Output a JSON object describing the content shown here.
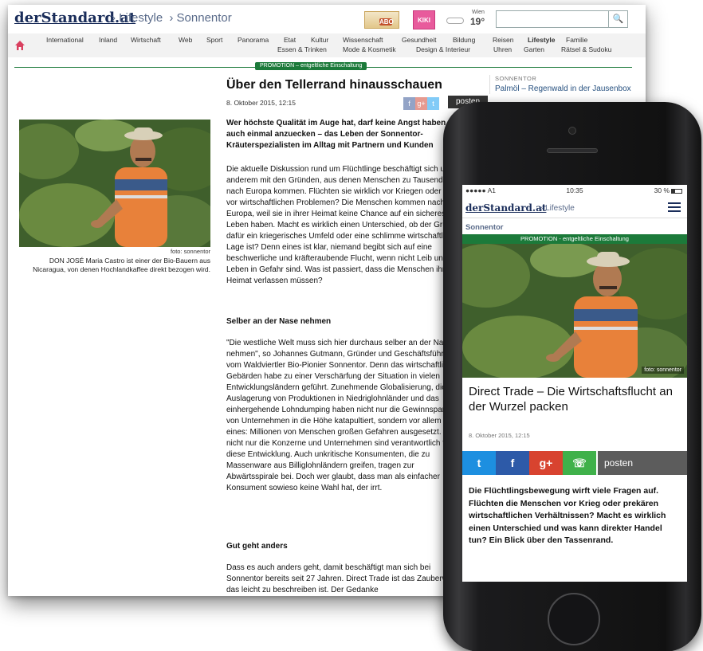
{
  "desktop": {
    "logo": "derStandard.at",
    "crumbs": [
      "› Lifestyle",
      "› Sonnentor"
    ],
    "badges": {
      "abo": "ABO",
      "kiki": "KIKI"
    },
    "weather": {
      "city": "Wien",
      "temp": "19°"
    },
    "search": {
      "placeholder": "",
      "button": "🔍"
    },
    "nav_top": [
      "International",
      "Inland",
      "Wirtschaft",
      "Web",
      "Sport",
      "Panorama",
      "Etat",
      "Kultur",
      "Wissenschaft",
      "Gesundheit",
      "Bildung",
      "Reisen",
      "Lifestyle",
      "Familie"
    ],
    "nav_sub": [
      "Essen & Trinken",
      "Mode & Kosmetik",
      "Design & Interieur",
      "Uhren",
      "Garten",
      "Rätsel & Sudoku"
    ],
    "promo": "PROMOTION – entgeltliche Einschaltung",
    "title": "Über den Tellerrand hinausschauen",
    "date": "8. Oktober 2015, 12:15",
    "share": [
      "f",
      "g+",
      "t"
    ],
    "posten": "posten",
    "lead": "Wer höchste Qualität im Auge hat, darf keine Angst haben, auch einmal anzuecken – das Leben der Sonnentor-Kräuterspezialisten im Alltag mit Partnern und Kunden",
    "para1": "Die aktuelle Diskussion rund um Flüchtlinge beschäftigt sich unter anderem mit den Gründen, aus denen Menschen zu Tausenden nach Europa kommen. Flüchten sie wirklich vor Kriegen oder gar vor wirtschaftlichen Problemen? Die Menschen kommen nach Europa, weil sie in ihrer Heimat keine Chance auf ein sicheres Leben haben. Macht es wirklich einen Unterschied, ob der Grund dafür ein kriegerisches Umfeld oder eine schlimme wirtschaftliche Lage ist? Denn eines ist klar, niemand begibt sich auf eine beschwerliche und kräfteraubende Flucht, wenn nicht Leib und Leben in Gefahr sind. Was ist passiert, dass die Menschen ihre Heimat verlassen müssen?",
    "sub1": "Selber an der Nase nehmen",
    "para2": "\"Die westliche Welt muss sich hier durchaus selber an der Nase nehmen\", so Johannes Gutmann, Gründer und Geschäftsführer vom Waldviertler Bio-Pionier Sonnentor. Denn das wirtschaftliche Gebärden habe zu einer Verschärfung der Situation in vielen Entwicklungsländern geführt. Zunehmende Globalisierung, die Auslagerung von Produktionen in Niedriglohnländer und das einhergehende Lohndumping haben nicht nur die Gewinnspanne von Unternehmen in die Höhe katapultiert, sondern vor allem auch eines: Millionen von Menschen großen Gefahren ausgesetzt. Doch nicht nur die Konzerne und Unternehmen sind verantwortlich für diese Entwicklung. Auch unkritische Konsumenten, die zu Massenware aus Billiglohnländern greifen, tragen zur Abwärtsspirale bei. Doch wer glaubt, dass man als einfacher Konsument sowieso keine Wahl hat, der irrt.",
    "sub2": "Gut geht anders",
    "para3": "Dass es auch anders geht, damit beschäftigt man sich bei Sonnentor bereits seit 27 Jahren. Direct Trade ist das Zauberwort, das leicht zu beschreiben ist. Der Gedanke",
    "photo_credit": "foto: sonnentor",
    "caption": "DON JOSÉ Maria Castro ist einer der Bio-Bauern aus Nicaragua, von denen Hochlandkaffee direkt bezogen wird.",
    "sidebar": {
      "kicker": "SONNENTOR",
      "link": "Palmöl – Regenwald in der Jausenbox"
    }
  },
  "phone": {
    "status": {
      "carrier": "●●●●● A1",
      "time": "10:35",
      "battery": "30 %",
      "battery_level": 0.3
    },
    "logo": "derStandard.at",
    "crumb": "› Lifestyle",
    "section": "Sonnentor",
    "promo": "PROMOTION - entgeltliche Einschaltung",
    "photo_credit": "foto: sonnentor",
    "title": "Direct Trade – Die Wirtschaftsflucht an der Wurzel packen",
    "date": "8. Oktober 2015, 12:15",
    "share": {
      "twitter": "t",
      "facebook": "f",
      "google": "g+",
      "whatsapp": "☏"
    },
    "posten": "posten",
    "lead": "Die Flüchtlingsbewegung wirft viele Fragen auf. Flüchten die Menschen vor Krieg oder prekären wirtschaftlichen Verhältnissen? Macht es wirklich einen Unterschied und was kann direkter Handel tun? Ein Blick über den Tassenrand."
  },
  "colors": {
    "brand": "#1a2d5a",
    "promo_green": "#1c7a3a",
    "twitter": "#1d8fe0",
    "facebook": "#2d5aa8",
    "google": "#d8432f",
    "whatsapp": "#3fb14a"
  }
}
